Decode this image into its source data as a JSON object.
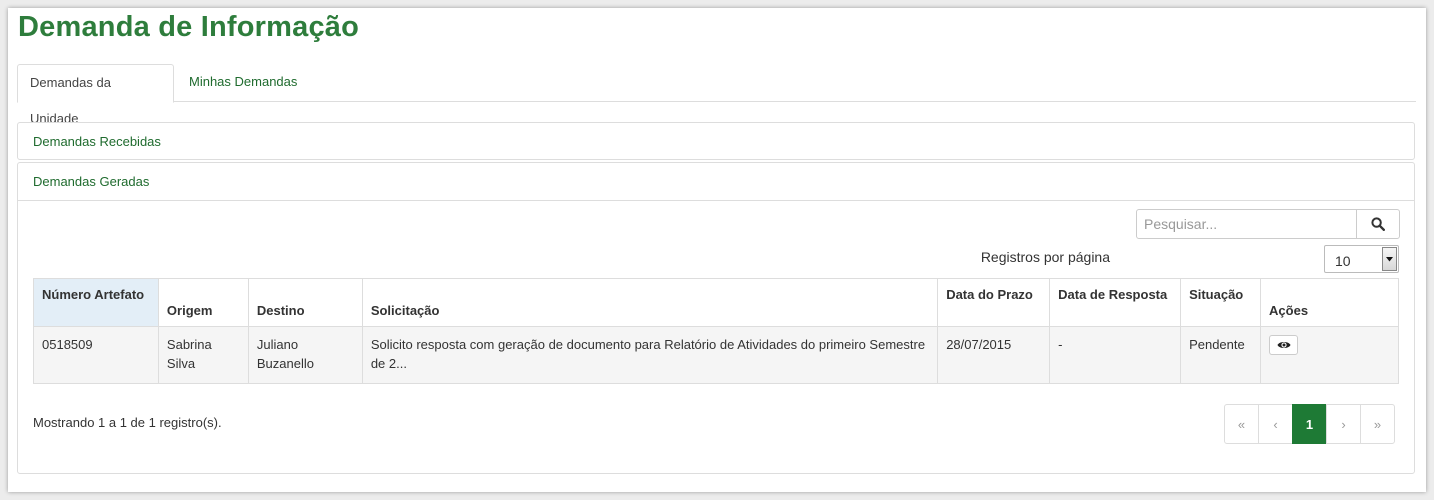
{
  "page": {
    "title": "Demanda de Informação"
  },
  "tabs": [
    {
      "label": "Demandas da Unidade",
      "active": true
    },
    {
      "label": "Minhas Demandas",
      "active": false
    }
  ],
  "panels": {
    "received": {
      "title": "Demandas Recebidas"
    },
    "generated": {
      "title": "Demandas Geradas"
    }
  },
  "search": {
    "placeholder": "Pesquisar...",
    "icon": "search-icon"
  },
  "per_page": {
    "label": "Registros por página",
    "value": "10"
  },
  "table": {
    "columns": [
      "Número Artefato",
      "Origem",
      "Destino",
      "Solicitação",
      "Data do Prazo",
      "Data de Resposta",
      "Situação",
      "Ações"
    ],
    "rows": [
      {
        "numero": "0518509",
        "origem": "Sabrina Silva",
        "destino": "Juliano Buzanello",
        "solicitacao": "Solicito resposta com geração de documento para Relatório de Atividades do primeiro Semestre de 2...",
        "prazo": "28/07/2015",
        "resposta": "-",
        "situacao": "Pendente",
        "acao_icon": "eye-icon"
      }
    ]
  },
  "footer": {
    "showing": "Mostrando 1 a 1 de 1 registro(s)."
  },
  "pagination": {
    "first": "«",
    "prev": "‹",
    "current": "1",
    "next": "›",
    "last": "»"
  },
  "colors": {
    "brand_green": "#2e7d3c",
    "active_page": "#1e7a35",
    "sorted_header": "#e3eef7"
  }
}
